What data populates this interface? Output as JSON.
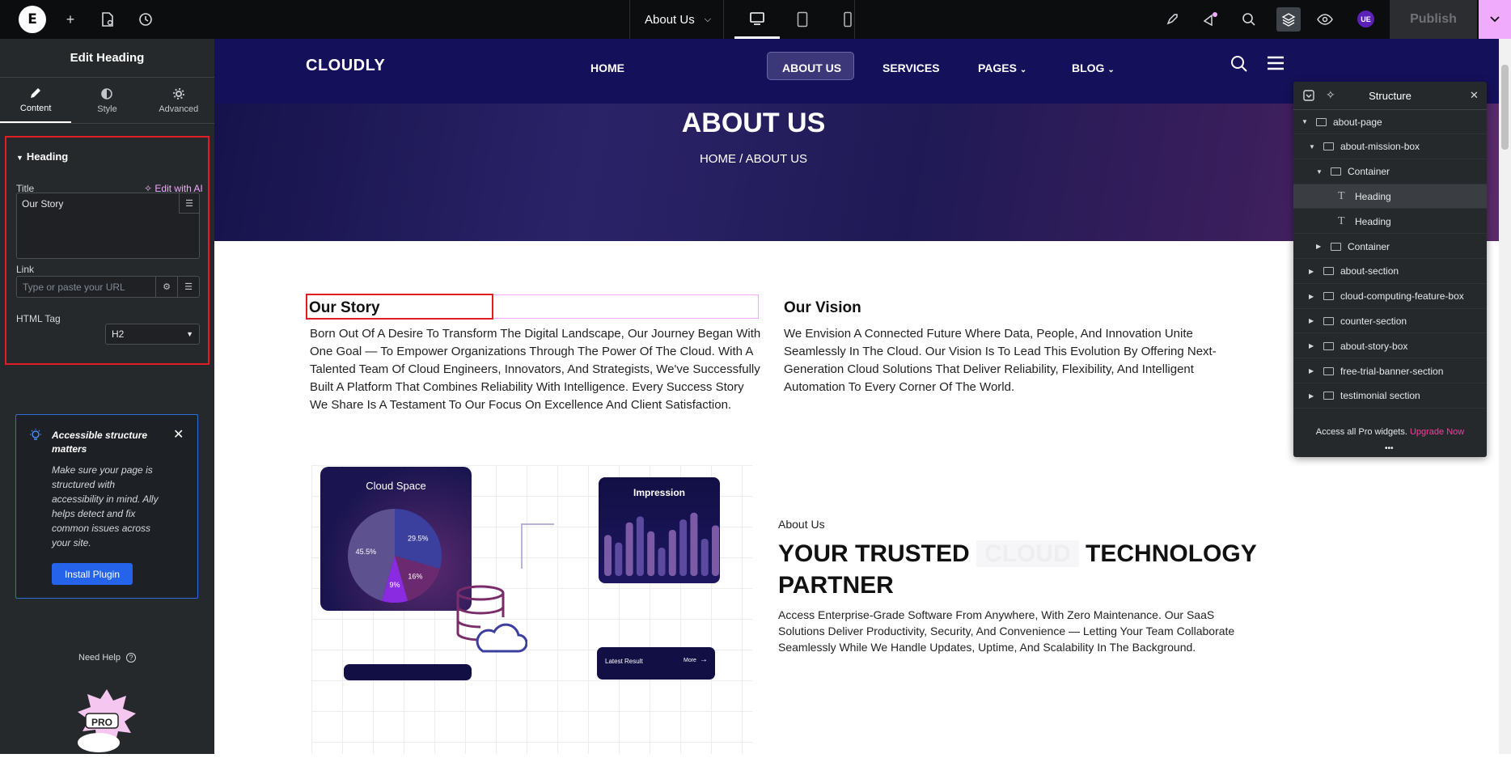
{
  "topbar": {
    "logo": "E",
    "page_name": "About Us",
    "publish_label": "Publish",
    "ue_badge": "UE"
  },
  "sidebar": {
    "title": "Edit Heading",
    "tabs": [
      {
        "label": "Content"
      },
      {
        "label": "Style"
      },
      {
        "label": "Advanced"
      }
    ],
    "section_heading": "Heading",
    "title_label": "Title",
    "edit_ai": "Edit with AI",
    "title_value": "Our Story",
    "link_label": "Link",
    "link_placeholder": "Type or paste your URL",
    "html_tag_label": "HTML Tag",
    "html_tag_value": "H2",
    "notice_title": "Accessible structure matters",
    "notice_body": "Make sure your page is structured with accessibility in mind. Ally helps detect and fix common issues across your site.",
    "install_label": "Install Plugin",
    "need_help": "Need Help",
    "pro_text": "PRO"
  },
  "site": {
    "brand": "CLOUDLY",
    "nav": [
      "HOME",
      "ABOUT US",
      "SERVICES",
      "PAGES",
      "BLOG"
    ],
    "hero_title": "ABOUT US",
    "breadcrumb": "HOME / ABOUT US",
    "story_heading": "Our Story",
    "story_text": "Born Out Of A Desire To Transform The Digital Landscape, Our Journey Began With One Goal — To Empower Organizations Through The Power Of The Cloud. With A Talented Team Of Cloud Engineers, Innovators, And Strategists, We've Successfully Built A Platform That Combines Reliability With Intelligence. Every Success Story We Share Is A Testament To Our Focus On Excellence And Client Satisfaction.",
    "vision_heading": "Our Vision",
    "vision_text": "We Envision A Connected Future Where Data, People, And Innovation Unite Seamlessly In The Cloud. Our Vision Is To Lead This Evolution By Offering Next-Generation Cloud Solutions That Deliver Reliability, Flexibility, And Intelligent Automation To Every Corner Of The World.",
    "cloud_card_title": "Cloud Space",
    "impression_title": "Impression",
    "latest_result": "Latest Result",
    "latest_more": "More",
    "about_label": "About Us",
    "about_heading_1": "YOUR TRUSTED",
    "about_heading_cloud": "CLOUD",
    "about_heading_2": "TECHNOLOGY PARTNER",
    "about_text": "Access Enterprise-Grade Software From Anywhere, With Zero Maintenance. Our SaaS Solutions Deliver Productivity, Security, And Convenience — Letting Your Team Collaborate Seamlessly While We Handle Updates, Uptime, And Scalability In The Background."
  },
  "pie": {
    "slices": [
      {
        "label": "29.5%",
        "value": 29.5,
        "color": "#3b3f9e"
      },
      {
        "label": "16%",
        "value": 16,
        "color": "#6b2a6f"
      },
      {
        "label": "9%",
        "value": 9,
        "color": "#8a2be2"
      },
      {
        "label": "45.5%",
        "value": 45.5,
        "color": "#5e5190"
      }
    ]
  },
  "bars": {
    "values": [
      0.55,
      0.45,
      0.72,
      0.8,
      0.6,
      0.38,
      0.62,
      0.76,
      0.85,
      0.5,
      0.68
    ]
  },
  "structure": {
    "title": "Structure",
    "items": [
      {
        "label": "about-page",
        "indent": 0,
        "expanded": true,
        "kind": "container"
      },
      {
        "label": "about-mission-box",
        "indent": 1,
        "expanded": true,
        "kind": "container"
      },
      {
        "label": "Container",
        "indent": 2,
        "expanded": true,
        "kind": "container"
      },
      {
        "label": "Heading",
        "indent": 3,
        "kind": "heading",
        "selected": true
      },
      {
        "label": "Heading",
        "indent": 3,
        "kind": "heading"
      },
      {
        "label": "Container",
        "indent": 2,
        "expanded": false,
        "kind": "container"
      },
      {
        "label": "about-section",
        "indent": 1,
        "expanded": false,
        "kind": "container"
      },
      {
        "label": "cloud-computing-feature-box",
        "indent": 1,
        "expanded": false,
        "kind": "container"
      },
      {
        "label": "counter-section",
        "indent": 1,
        "expanded": false,
        "kind": "container"
      },
      {
        "label": "about-story-box",
        "indent": 1,
        "expanded": false,
        "kind": "container"
      },
      {
        "label": "free-trial-banner-section",
        "indent": 1,
        "expanded": false,
        "kind": "container"
      },
      {
        "label": "testimonial section",
        "indent": 1,
        "expanded": false,
        "kind": "container"
      }
    ],
    "footer_text": "Access all Pro widgets.",
    "footer_link": "Upgrade Now"
  }
}
